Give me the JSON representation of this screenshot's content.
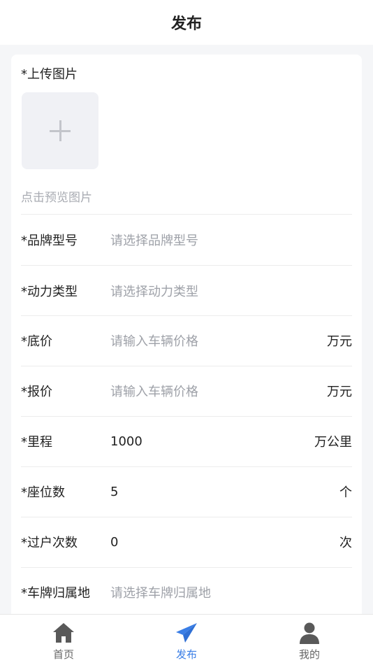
{
  "header": {
    "title": "发布"
  },
  "upload": {
    "label": "*上传图片",
    "hint": "点击预览图片"
  },
  "form": {
    "rows": [
      {
        "label": "*品牌型号",
        "value": "请选择品牌型号",
        "unit": ""
      },
      {
        "label": "*动力类型",
        "value": "请选择动力类型",
        "unit": ""
      },
      {
        "label": "*底价",
        "value": "请输入车辆价格",
        "unit": "万元"
      },
      {
        "label": "*报价",
        "value": "请输入车辆价格",
        "unit": "万元"
      },
      {
        "label": "*里程",
        "value": "1000",
        "unit": "万公里"
      },
      {
        "label": "*座位数",
        "value": "5",
        "unit": "个"
      },
      {
        "label": "*过户次数",
        "value": "0",
        "unit": "次"
      },
      {
        "label": "*车牌归属地",
        "value": "请选择车牌归属地",
        "unit": ""
      }
    ]
  },
  "tabbar": {
    "tabs": [
      {
        "label": "首页",
        "icon": "home-icon"
      },
      {
        "label": "发布",
        "icon": "paper-plane-icon"
      },
      {
        "label": "我的",
        "icon": "user-icon"
      }
    ],
    "active_index": 1,
    "active_color": "#3a7ee6",
    "inactive_color": "#666666"
  }
}
